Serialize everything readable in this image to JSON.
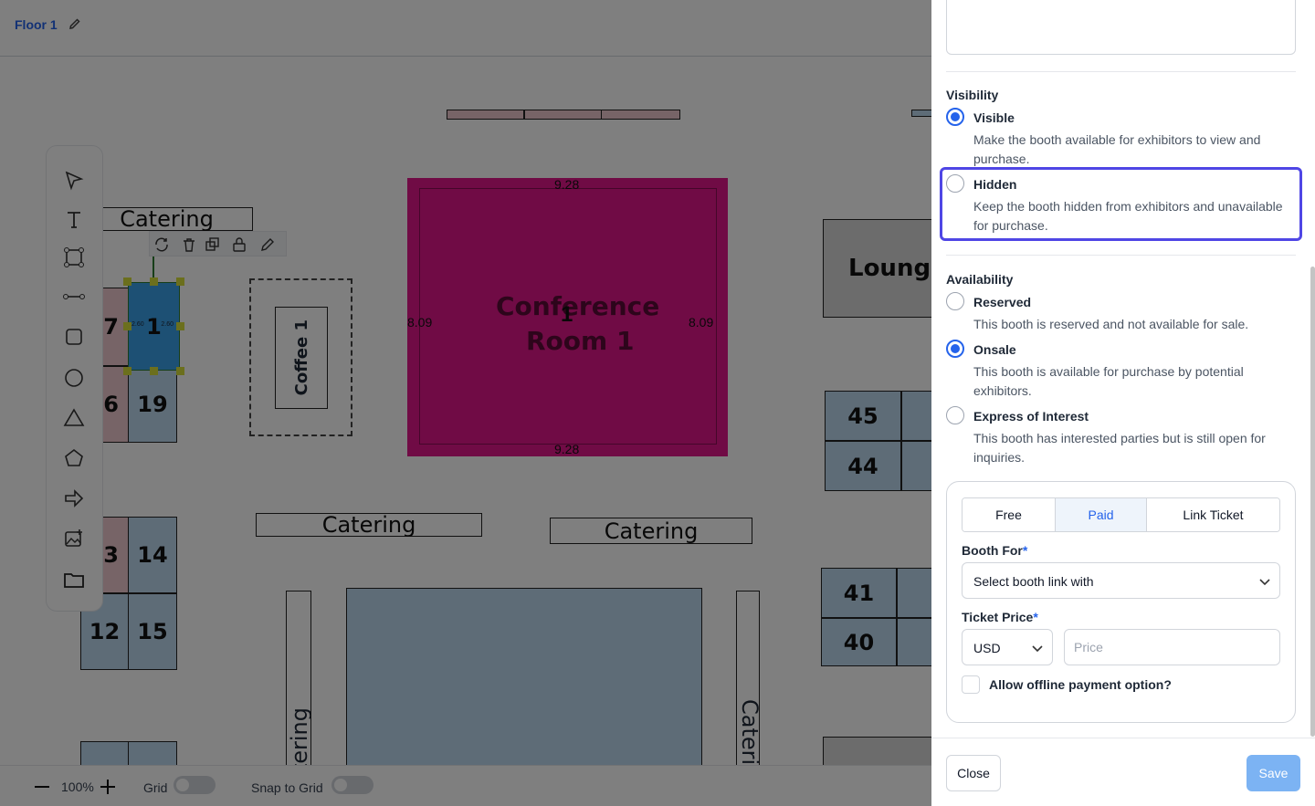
{
  "floor": {
    "title": "Floor 1",
    "plan": {
      "booths": [
        {
          "num": "7",
          "color": "pink"
        },
        {
          "num": "6",
          "color": "pink"
        },
        {
          "num": "19",
          "color": "blue"
        },
        {
          "num": "1",
          "color": "blue"
        },
        {
          "num": "3",
          "color": "pink"
        },
        {
          "num": "14",
          "color": "blue"
        },
        {
          "num": "12",
          "color": "blue"
        },
        {
          "num": "15",
          "color": "blue"
        },
        {
          "num": "45",
          "color": "blue"
        },
        {
          "num": "44",
          "color": "blue"
        },
        {
          "num": "41",
          "color": "blue"
        },
        {
          "num": "40",
          "color": "blue"
        }
      ],
      "labels": {
        "catering_top": "Catering",
        "catering_mid1": "Catering",
        "catering_mid2": "Catering",
        "catering_vert_left": "tering",
        "catering_vert_right": "Cateri",
        "coffee": "Coffee 1",
        "lounge": "Lounge",
        "conference_num": "1",
        "conference_line1": "Conference",
        "conference_line2": "Room 1",
        "dim_top": "9.28",
        "dim_bottom": "9.28",
        "dim_left": "8.09",
        "dim_right": "8.09",
        "sel_dim_left": "2.60",
        "sel_dim_right": "2.60"
      }
    },
    "footer": {
      "zoom": "100%",
      "grid_label": "Grid",
      "snap_label": "Snap to Grid"
    }
  },
  "panel": {
    "visibility": {
      "title": "Visibility",
      "options": [
        {
          "label": "Visible",
          "desc": "Make the booth available for exhibitors to view and purchase.",
          "selected": true
        },
        {
          "label": "Hidden",
          "desc": "Keep the booth hidden from exhibitors and unavailable for purchase.",
          "selected": false
        }
      ]
    },
    "availability": {
      "title": "Availability",
      "options": [
        {
          "label": "Reserved",
          "desc": "This booth is reserved and not available for sale.",
          "selected": false
        },
        {
          "label": "Onsale",
          "desc": "This booth is available for purchase by potential exhibitors.",
          "selected": true
        },
        {
          "label": "Express of Interest",
          "desc": "This booth has interested parties but is still open for inquiries.",
          "selected": false
        }
      ]
    },
    "pricing": {
      "tabs": [
        "Free",
        "Paid",
        "Link Ticket"
      ],
      "active_tab": "Paid",
      "booth_for_label": "Booth For",
      "booth_for_value": "Select booth link with",
      "ticket_price_label": "Ticket Price",
      "required_mark": "*",
      "currency": "USD",
      "price_placeholder": "Price",
      "offline_label": "Allow offline payment option?"
    },
    "actions": {
      "close": "Close",
      "save": "Save"
    }
  },
  "colors": {
    "accent": "#2563eb",
    "focus": "#4f46e5",
    "save_disabled": "#7cb3f3",
    "booth_blue": "#bcd9ef",
    "booth_pink": "#efc9cf",
    "conference": "#e0168a"
  }
}
